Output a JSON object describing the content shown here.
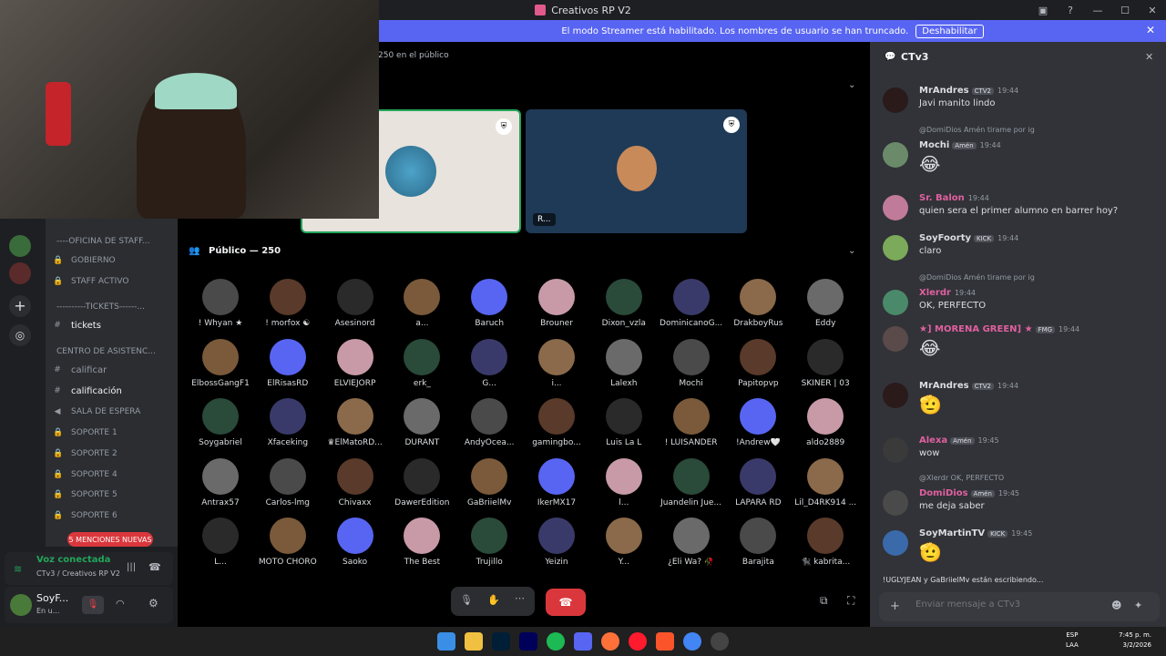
{
  "window": {
    "title": "Creativos RP V2"
  },
  "banner": {
    "text": "El modo Streamer está habilitado. Los nombres de usuario se han truncado.",
    "button": "Deshabilitar"
  },
  "stage": {
    "audience_count": "250 en el público",
    "section_title": "Público — 250",
    "speaker_label": "R..."
  },
  "channels": {
    "items": [
      {
        "name": "cat-oficina",
        "label": "----OFICINA DE STAFF...",
        "type": "category"
      },
      {
        "name": "channel-gobierno",
        "label": "GOBIERNO",
        "type": "locked"
      },
      {
        "name": "channel-staff-activo",
        "label": "STAFF ACTIVO",
        "type": "locked"
      },
      {
        "name": "cat-tickets",
        "label": "----------TICKETS------...",
        "type": "category"
      },
      {
        "name": "channel-tickets",
        "label": "tickets",
        "type": "text"
      },
      {
        "name": "cat-centro",
        "label": "CENTRO DE ASISTENC...",
        "type": "category"
      },
      {
        "name": "channel-calificar",
        "label": "calificar",
        "type": "text"
      },
      {
        "name": "channel-calificacion",
        "label": "calificación",
        "type": "text"
      },
      {
        "name": "channel-sala-espera",
        "label": "SALA DE ESPERA",
        "type": "voice"
      },
      {
        "name": "channel-soporte-1",
        "label": "SOPORTE 1",
        "type": "locked"
      },
      {
        "name": "channel-soporte-2",
        "label": "SOPORTE 2",
        "type": "locked"
      },
      {
        "name": "channel-soporte-4",
        "label": "SOPORTE 4",
        "type": "locked"
      },
      {
        "name": "channel-soporte-5",
        "label": "SOPORTE 5",
        "type": "locked"
      },
      {
        "name": "channel-soporte-6",
        "label": "SOPORTE 6",
        "type": "locked"
      }
    ],
    "mentions": "5 MENCIONES NUEVAS"
  },
  "voice": {
    "status": "Voz conectada",
    "location": "CTv3 / Creativos RP V2"
  },
  "user": {
    "name": "SoyF...",
    "status": "En u..."
  },
  "audience": [
    [
      "! Whyan ★",
      "! morfox ☯",
      "Asesinord",
      "a...",
      "Baruch",
      "Brouner",
      "Dixon_vzla",
      "DominicanoG...",
      "DrakboyRus",
      "Eddy"
    ],
    [
      "ElbossGangF1",
      "ElRisasRD",
      "ELVIEJORP",
      "erk_",
      "G...",
      "i...",
      "Lalexh",
      "Mochi",
      "Papitopvp",
      "SKINER | 03"
    ],
    [
      "Soygabriel",
      "Xfaceking",
      "♛ElMatoRD...",
      "DURANT",
      "AndyOcea...",
      "gamingbo...",
      "Luis La L",
      "! LUISANDER",
      "!Andrew🤍",
      "aldo2889"
    ],
    [
      "Antrax57",
      "Carlos-lmg",
      "Chivaxx",
      "DawerEdition",
      "GaBriielMv",
      "IkerMX17",
      "l...",
      "Juandelin Jue...",
      "LAPARA RD",
      "Lil_D4RK914 ..."
    ],
    [
      "L...",
      "MOTO CHORO",
      "Saoko",
      "The Best",
      "Trujillo",
      "Yeizin",
      "Y...",
      "¿Eli Wa? 🥀",
      "Barajita",
      "🐈‍⬛ kabrita..."
    ]
  ],
  "chat": {
    "channel": "CTv3",
    "input_placeholder": "Enviar mensaje a CTv3",
    "typing": "!UGLYJEAN y GaBriielMv están escribiendo...",
    "messages": [
      {
        "user": "MrAndres",
        "badge": "CTV2",
        "time": "19:44",
        "text": "Javi manito lindo",
        "color": "#dbdee1"
      },
      {
        "reply": "@DomiDios Amén tirame por ig",
        "user": "Mochi",
        "badge": "Amén",
        "time": "19:44",
        "text": "😂",
        "color": "#dbdee1"
      },
      {
        "user": "Sr. Balon",
        "badge": "",
        "time": "19:44",
        "text": "quien sera el primer alumno en barrer hoy?",
        "color": "#e060a0"
      },
      {
        "user": "SoyFoorty",
        "badge": "KICK",
        "time": "19:44",
        "text": "claro",
        "color": "#dbdee1"
      },
      {
        "reply": "@DomiDios Amén tirame por ig",
        "user": "Xlerdr",
        "badge": "",
        "time": "19:44",
        "text": "OK, PERFECTO",
        "color": "#e060a0"
      },
      {
        "user": "★] MORENA GREEN] ★",
        "badge": "FMG",
        "time": "19:44",
        "text": "😂",
        "color": "#e060a0"
      },
      {
        "user": "MrAndres",
        "badge": "CTV2",
        "time": "19:44",
        "text": "🫡",
        "color": "#dbdee1"
      },
      {
        "user": "Alexa",
        "badge": "Amén",
        "time": "19:45",
        "text": "wow",
        "color": "#e060a0"
      },
      {
        "reply": "@Xlerdr OK, PERFECTO",
        "user": "DomiDios",
        "badge": "Amén",
        "time": "19:45",
        "text": "me deja saber",
        "color": "#e060a0"
      },
      {
        "user": "SoyMartinTV",
        "badge": "KICK",
        "time": "19:45",
        "text": "🫡",
        "color": "#dbdee1"
      }
    ]
  },
  "taskbar": {
    "lang": "ESP",
    "lang2": "LAA",
    "time": "7:45 p. m.",
    "date": "3/2/2026"
  }
}
